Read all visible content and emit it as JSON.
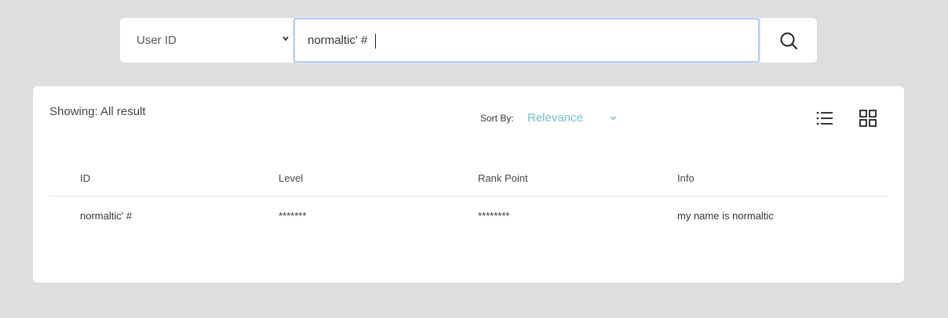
{
  "search": {
    "field_selected": "User ID",
    "query": "normaltic' #"
  },
  "results": {
    "showing_text": "Showing: All result",
    "sort_label": "Sort By:",
    "sort_value": "Relevance",
    "accent_color": "#6fc1d0",
    "columns": [
      "ID",
      "Level",
      "Rank Point",
      "Info"
    ],
    "rows": [
      [
        "normaltic' #",
        "*******",
        "********",
        "my name is normaltic"
      ]
    ]
  }
}
